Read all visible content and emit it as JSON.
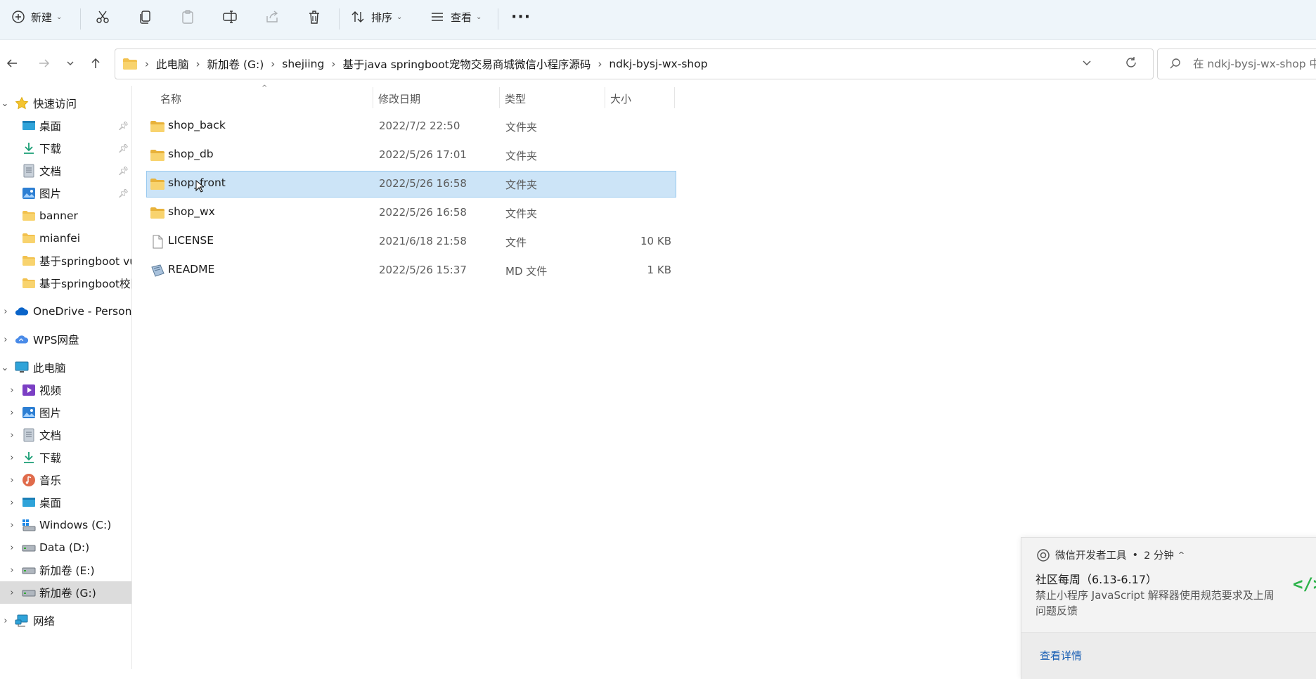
{
  "toolbar": {
    "new_label": "新建",
    "sort_label": "排序",
    "view_label": "查看",
    "more_label": "···"
  },
  "address": {
    "crumbs": [
      "此电脑",
      "新加卷 (G:)",
      "shejiing",
      "基于java springboot宠物交易商城微信小程序源码",
      "ndkj-bysj-wx-shop"
    ],
    "search_placeholder": "在 ndkj-bysj-wx-shop 中搜索"
  },
  "nav": {
    "quick_access": "快速访问",
    "pinned": [
      "桌面",
      "下载",
      "文档",
      "图片"
    ],
    "recent": [
      "banner",
      "mianfei",
      "基于springboot vue",
      "基于springboot校园"
    ],
    "onedrive": "OneDrive - Personal",
    "wps": "WPS网盘",
    "this_pc": "此电脑",
    "pc_items": [
      "视频",
      "图片",
      "文档",
      "下载",
      "音乐",
      "桌面",
      "Windows (C:)",
      "Data (D:)",
      "新加卷 (E:)",
      "新加卷 (G:)"
    ],
    "network": "网络"
  },
  "columns": {
    "name": "名称",
    "date": "修改日期",
    "type": "类型",
    "size": "大小"
  },
  "files": [
    {
      "name": "shop_back",
      "date": "2022/7/2 22:50",
      "type": "文件夹",
      "size": "",
      "kind": "folder"
    },
    {
      "name": "shop_db",
      "date": "2022/5/26 17:01",
      "type": "文件夹",
      "size": "",
      "kind": "folder"
    },
    {
      "name": "shop_front",
      "date": "2022/5/26 16:58",
      "type": "文件夹",
      "size": "",
      "kind": "folder",
      "selected": true
    },
    {
      "name": "shop_wx",
      "date": "2022/5/26 16:58",
      "type": "文件夹",
      "size": "",
      "kind": "folder"
    },
    {
      "name": "LICENSE",
      "date": "2021/6/18 21:58",
      "type": "文件",
      "size": "10 KB",
      "kind": "file"
    },
    {
      "name": "README",
      "date": "2022/5/26 15:37",
      "type": "MD 文件",
      "size": "1 KB",
      "kind": "md"
    }
  ],
  "toast": {
    "app": "微信开发者工具",
    "dot": "•",
    "time": "2 分钟",
    "title": "社区每周（6.13-6.17）",
    "body": "禁止小程序 JavaScript 解释器使用规范要求及上周问题反馈",
    "link": "查看详情"
  },
  "colors": {
    "accent": "#0067c0",
    "selection": "#cce4f7",
    "folder": "#f2c14e",
    "toolbar_bg": "#eef5fa"
  }
}
